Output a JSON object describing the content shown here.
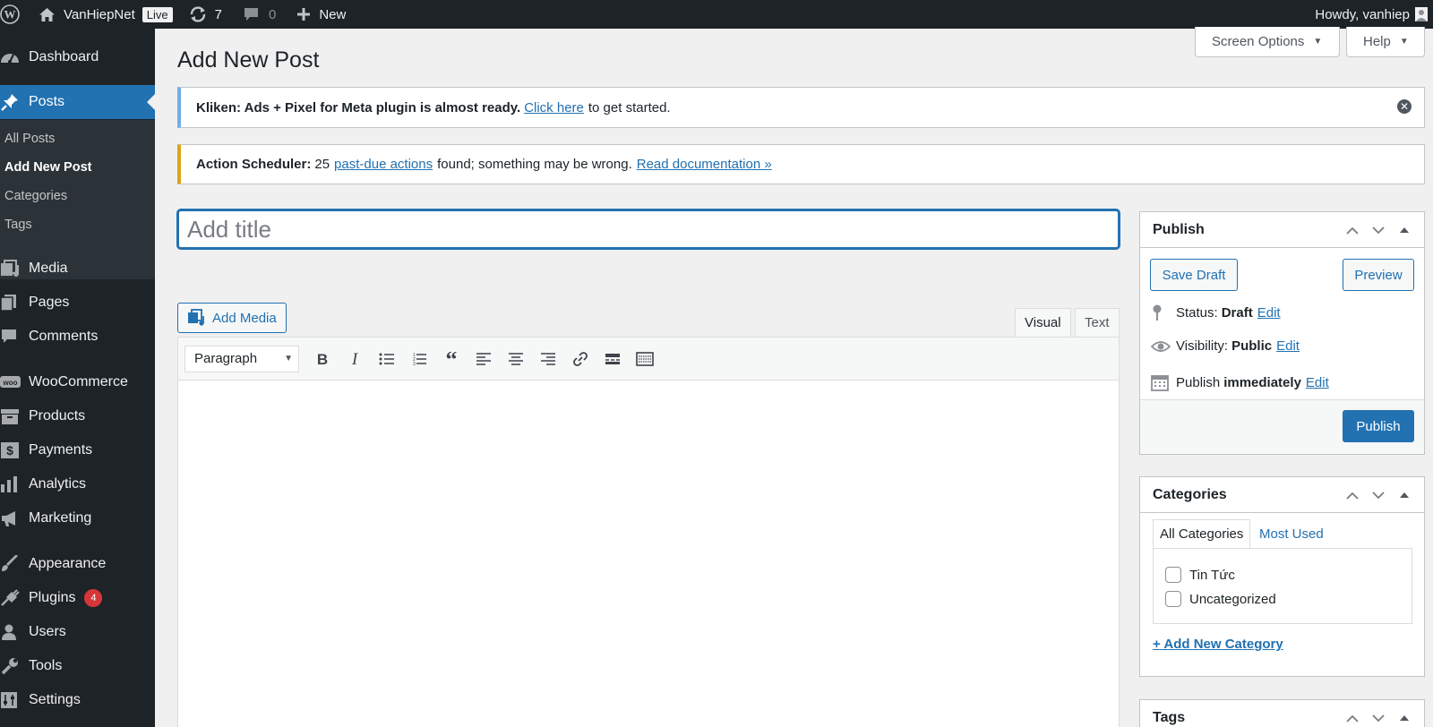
{
  "adminbar": {
    "site_name": "VanHiepNet",
    "live_badge": "Live",
    "updates_count": "7",
    "comments_count": "0",
    "new_label": "New",
    "howdy": "Howdy, vanhiep",
    "bg_color": "#1d2327"
  },
  "sidebar": {
    "items": [
      {
        "label": "Dashboard",
        "icon": "dashboard-icon"
      },
      {
        "label": "Posts",
        "icon": "pin-icon"
      },
      {
        "label": "Media",
        "icon": "media-icon"
      },
      {
        "label": "Pages",
        "icon": "pages-icon"
      },
      {
        "label": "Comments",
        "icon": "comment-icon"
      },
      {
        "label": "WooCommerce",
        "icon": "woo-icon"
      },
      {
        "label": "Products",
        "icon": "archive-icon"
      },
      {
        "label": "Payments",
        "icon": "dollar-icon"
      },
      {
        "label": "Analytics",
        "icon": "bar-chart-icon"
      },
      {
        "label": "Marketing",
        "icon": "megaphone-icon"
      },
      {
        "label": "Appearance",
        "icon": "brush-icon"
      },
      {
        "label": "Plugins",
        "icon": "plug-icon",
        "badge": "4"
      },
      {
        "label": "Users",
        "icon": "user-icon"
      },
      {
        "label": "Tools",
        "icon": "wrench-icon"
      },
      {
        "label": "Settings",
        "icon": "settings-icon"
      }
    ],
    "submenu": [
      "All Posts",
      "Add New Post",
      "Categories",
      "Tags"
    ],
    "accent": "#2271b1"
  },
  "header": {
    "screen_options": "Screen Options",
    "help": "Help",
    "title": "Add New Post"
  },
  "notices": {
    "kliken_strong": "Kliken: Ads + Pixel for Meta plugin is almost ready.",
    "kliken_link": "Click here",
    "kliken_tail": "to get started.",
    "as_strong": "Action Scheduler:",
    "as_count": "25",
    "as_link": "past-due actions",
    "as_mid": "found; something may be wrong.",
    "as_doc": "Read documentation »"
  },
  "editor": {
    "title_placeholder": "Add title",
    "add_media": "Add Media",
    "tab_visual": "Visual",
    "tab_text": "Text",
    "format": "Paragraph"
  },
  "publish": {
    "title": "Publish",
    "save_draft": "Save Draft",
    "preview": "Preview",
    "status_label": "Status:",
    "status_value": "Draft",
    "visibility_label": "Visibility:",
    "visibility_value": "Public",
    "publish_label": "Publish",
    "publish_value": "immediately",
    "edit": "Edit",
    "publish_button": "Publish"
  },
  "categories": {
    "title": "Categories",
    "tab_all": "All Categories",
    "tab_most": "Most Used",
    "items": [
      "Tin Tức",
      "Uncategorized"
    ],
    "add_new": "+ Add New Category"
  },
  "tags": {
    "title": "Tags"
  }
}
